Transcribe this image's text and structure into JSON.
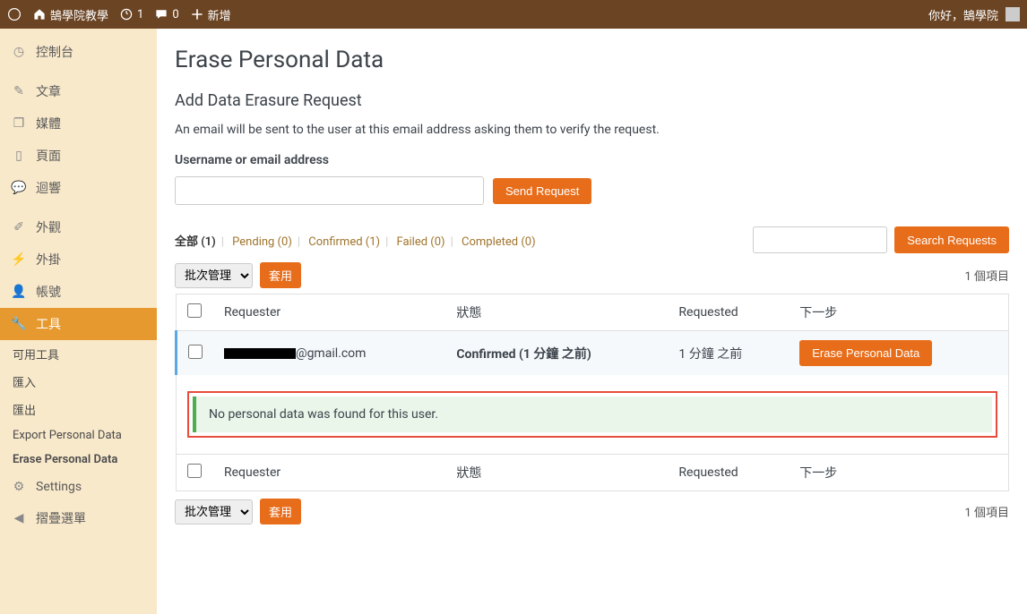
{
  "topbar": {
    "site_name": "鵠學院教學",
    "updates": "1",
    "comments": "0",
    "new_label": "新增",
    "greeting": "你好，鵠學院"
  },
  "sidebar": {
    "items": [
      {
        "label": "控制台",
        "icon": "dashboard"
      },
      {
        "label": "文章",
        "icon": "pin"
      },
      {
        "label": "媒體",
        "icon": "media"
      },
      {
        "label": "頁面",
        "icon": "page"
      },
      {
        "label": "迴響",
        "icon": "comment"
      },
      {
        "label": "外觀",
        "icon": "brush"
      },
      {
        "label": "外掛",
        "icon": "plug"
      },
      {
        "label": "帳號",
        "icon": "user"
      },
      {
        "label": "工具",
        "icon": "wrench",
        "active": true
      },
      {
        "label": "Settings",
        "icon": "sliders"
      },
      {
        "label": "摺疊選單",
        "icon": "collapse"
      }
    ],
    "sub": [
      {
        "label": "可用工具"
      },
      {
        "label": "匯入"
      },
      {
        "label": "匯出"
      },
      {
        "label": "Export Personal Data"
      },
      {
        "label": "Erase Personal Data",
        "current": true
      }
    ]
  },
  "page": {
    "title": "Erase Personal Data",
    "subtitle": "Add Data Erasure Request",
    "desc": "An email will be sent to the user at this email address asking them to verify the request.",
    "field_label": "Username or email address",
    "send_btn": "Send Request"
  },
  "filters": {
    "all": "全部 (1)",
    "pending": "Pending (0)",
    "confirmed": "Confirmed (1)",
    "failed": "Failed (0)",
    "completed": "Completed (0)"
  },
  "search_btn": "Search Requests",
  "bulk": {
    "select_label": "批次管理",
    "apply": "套用"
  },
  "count_label": "1 個項目",
  "columns": {
    "requester": "Requester",
    "status": "狀態",
    "requested": "Requested",
    "next": "下一步"
  },
  "row": {
    "email_suffix": "@gmail.com",
    "status": "Confirmed (1 分鐘 之前)",
    "requested": "1 分鐘 之前",
    "action": "Erase Personal Data"
  },
  "notice": "No personal data was found for this user."
}
